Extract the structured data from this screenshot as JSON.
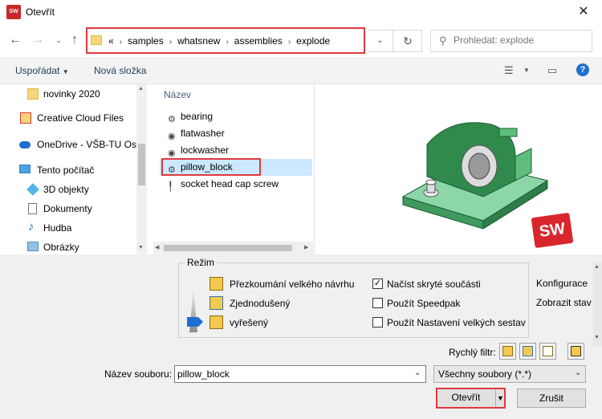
{
  "window": {
    "title": "Otevřít",
    "app_icon_text": "SW\n2020"
  },
  "address": {
    "crumbs": [
      "samples",
      "whatsnew",
      "assemblies",
      "explode"
    ],
    "overflow": "«",
    "search_placeholder": "Prohledat: explode"
  },
  "toolbar": {
    "organize_label": "Uspořádat",
    "new_folder_label": "Nová složka"
  },
  "nav": {
    "items": [
      {
        "label": "novinky 2020",
        "icon": "folder-icon"
      },
      {
        "label": "Creative Cloud Files",
        "icon": "creative-cloud-icon"
      },
      {
        "label": "OneDrive - VŠB-TU Ost",
        "icon": "cloud-icon"
      },
      {
        "label": "Tento počítač",
        "icon": "computer-icon"
      },
      {
        "label": "3D objekty",
        "icon": "cube-icon"
      },
      {
        "label": "Dokumenty",
        "icon": "document-icon"
      },
      {
        "label": "Hudba",
        "icon": "music-icon"
      },
      {
        "label": "Obrázky",
        "icon": "pictures-icon"
      }
    ]
  },
  "files": {
    "column_header": "Název",
    "rows": [
      {
        "name": "bearing"
      },
      {
        "name": "flatwasher"
      },
      {
        "name": "lockwasher"
      },
      {
        "name": "pillow_block",
        "selected": true
      },
      {
        "name": "socket head cap screw"
      }
    ]
  },
  "mode": {
    "group_label": "Režim",
    "options": [
      "Přezkoumání velkého návrhu",
      "Zjednodušený",
      "vyřešený"
    ],
    "checkboxes": [
      {
        "label": "Načíst skryté součásti",
        "checked": true
      },
      {
        "label": "Použít Speedpak",
        "checked": false
      },
      {
        "label": "Použít Nastavení velkých sestav",
        "checked": false
      }
    ],
    "config_label": "Konfigurace",
    "show_label": "Zobrazit stav"
  },
  "filter": {
    "label": "Rychlý filtr:"
  },
  "filename": {
    "label": "Název souboru:",
    "value": "pillow_block",
    "type_value": "Všechny soubory (*.*)"
  },
  "buttons": {
    "open_label": "Otevřít",
    "cancel_label": "Zrušit"
  },
  "preview": {
    "logo_text": "SW"
  }
}
